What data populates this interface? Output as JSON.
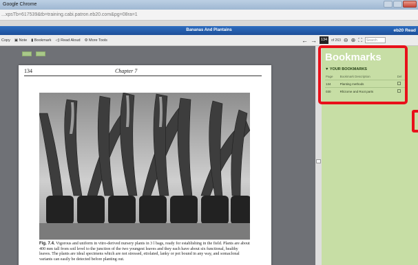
{
  "window": {
    "title": "Google Chrome"
  },
  "address": {
    "url": "...xpsTb=617539&tb=training.cabi.patron.eb20.com&pg=08ra=1"
  },
  "app": {
    "book_title": "Bananas And Plantains",
    "brand": "eb20 Read"
  },
  "toolbar": {
    "items": [
      "Copy",
      "Note",
      "Bookmark",
      "Read Aloud",
      "More Tools"
    ],
    "page_value": "134",
    "page_of": "of 263",
    "search_placeholder": "Search"
  },
  "page": {
    "number": "134",
    "chapter": "Chapter 7",
    "caption_label": "Fig. 7.4.",
    "caption_text": "Vigorous and uniform in vitro-derived nursery plants in 3 l bags, ready for establishing in the field. Plants are about 400 mm tall from soil level to the junction of the two youngest leaves and they each have about six functional, healthy leaves. The plants are ideal specimens which are not stressed, etiolated, lanky or pot bound in any way, and somaclonal variants can easily be detected before planting out."
  },
  "bookmarks": {
    "title": "Bookmarks",
    "section": "YOUR BOOKMARKS",
    "columns": [
      "Page",
      "Bookmark Description",
      "Del"
    ],
    "rows": [
      {
        "page": "134",
        "description": "Planting methods"
      },
      {
        "page": "030",
        "description": "Rhizome and Root parts"
      }
    ]
  },
  "colors": {
    "highlight": "#e8101a",
    "panel": "#c7dea5",
    "header_blue": "#1d4f98"
  }
}
